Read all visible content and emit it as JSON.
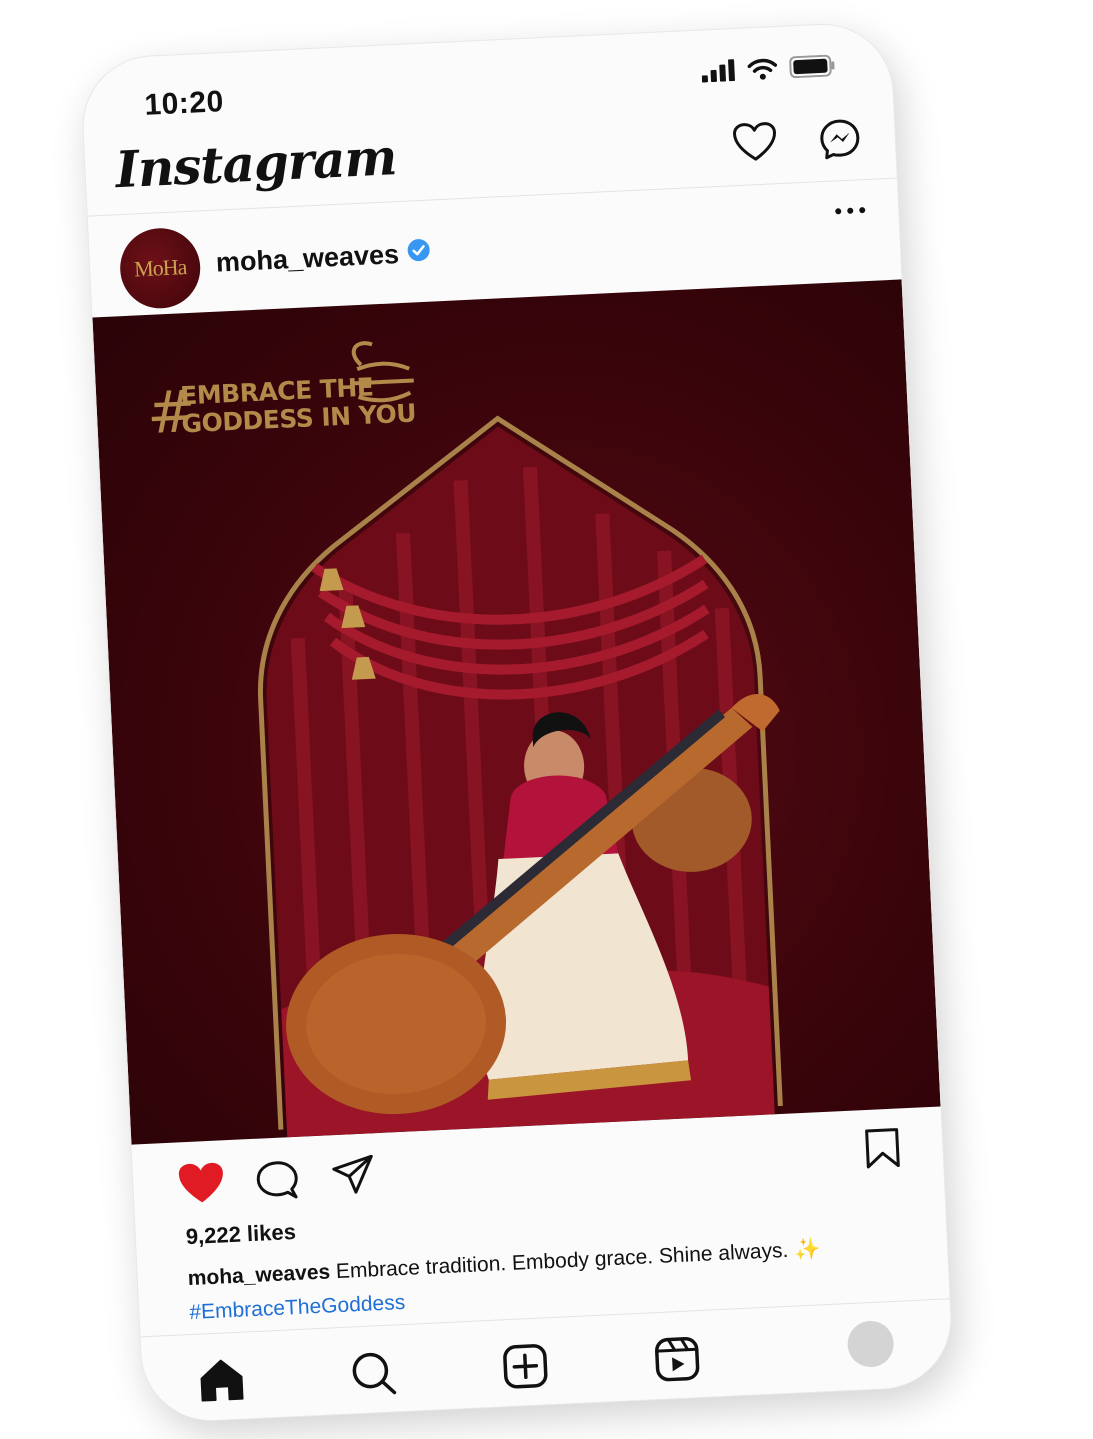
{
  "status_bar": {
    "time": "10:20"
  },
  "app": {
    "name": "Instagram"
  },
  "post": {
    "username": "moha_weaves",
    "avatar_text": "MoHa",
    "verified": true,
    "image": {
      "tagline_hash": "#",
      "tagline_line1": "EMBRACE THE",
      "tagline_line2": "GODDESS IN YOU"
    },
    "liked": true,
    "likes": "9,222 likes",
    "caption_username": "moha_weaves",
    "caption_text": "Embrace tradition. Embody grace. Shine always. ✨",
    "hashtag": "#EmbraceTheGoddess"
  },
  "colors": {
    "like_red": "#e01b24",
    "link_blue": "#1f6fd6",
    "verified_blue": "#3897f0",
    "gold": "#b48a4a",
    "maroon": "#3b050b"
  },
  "icons": [
    "cellular-signal-icon",
    "wifi-icon",
    "battery-icon",
    "heart-outline-icon",
    "messenger-icon",
    "more-options-icon",
    "heart-filled-icon",
    "comment-icon",
    "share-icon",
    "bookmark-icon",
    "home-icon",
    "search-icon",
    "create-icon",
    "reels-icon"
  ]
}
